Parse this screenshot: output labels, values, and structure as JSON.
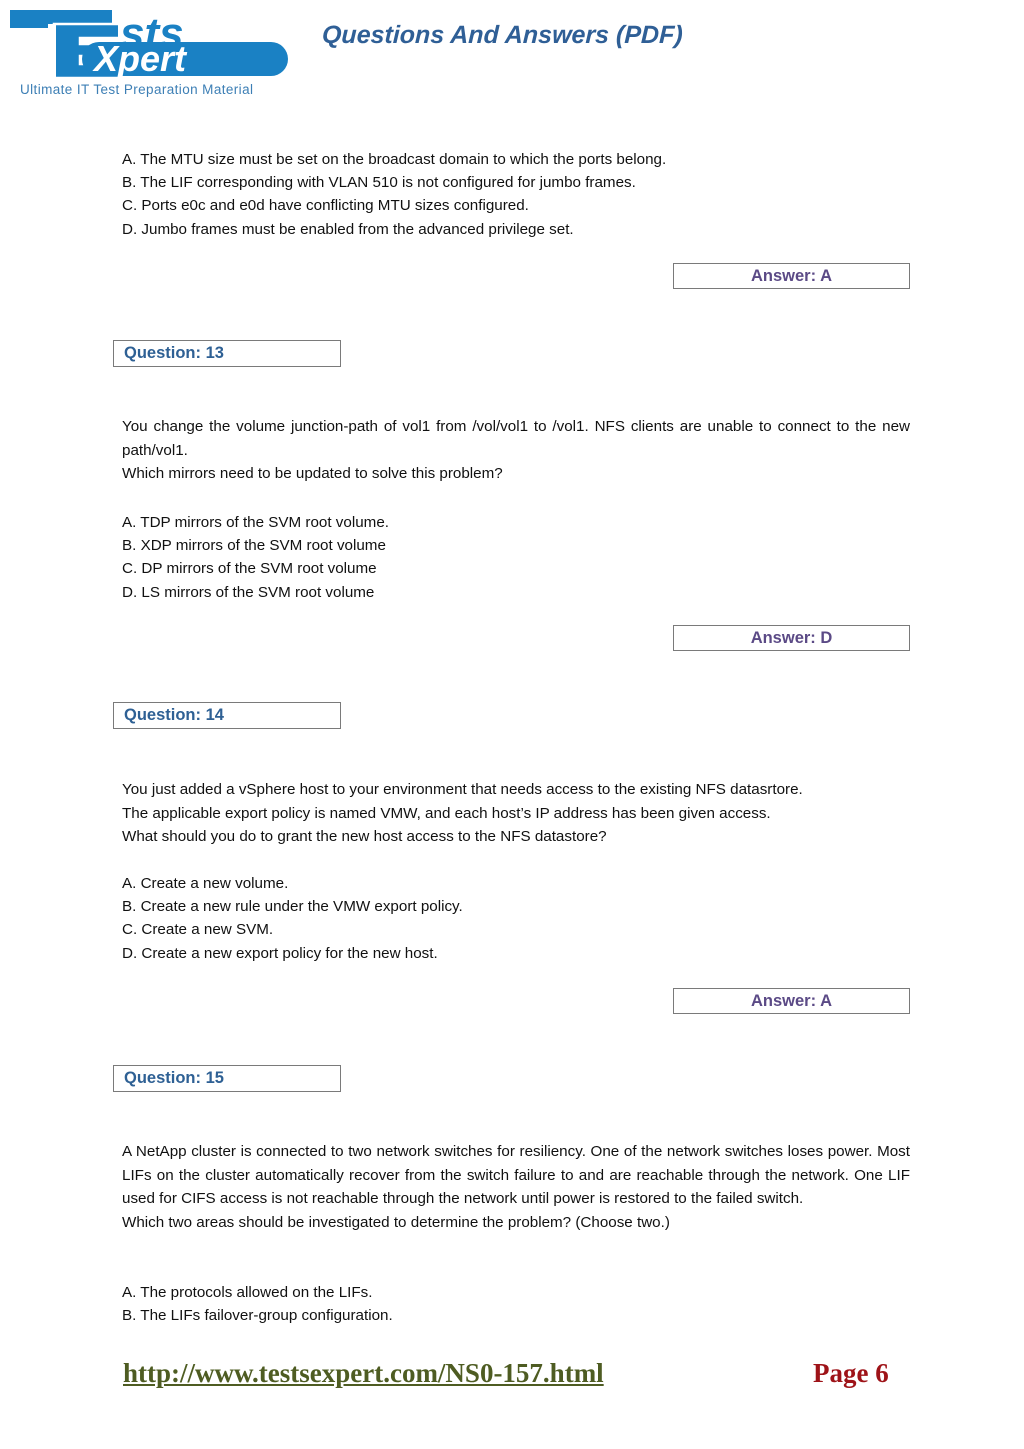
{
  "header": {
    "logo": {
      "name": "TestsExpert",
      "text_tests": "Tests",
      "text_expert": "Xpert",
      "text_e": "E",
      "text_t": "T",
      "tagline": "Ultimate IT Test Preparation Material",
      "brand_color": "#1a81c4"
    },
    "title": "Questions And Answers (PDF)",
    "title_color": "#2f5f96"
  },
  "colors": {
    "question_label": "#2e6094",
    "answer_label": "#5b4a86",
    "box_border": "#7a7a7a",
    "footer_url": "#4e5c22",
    "footer_page": "#9e1318",
    "body_text": "#111111"
  },
  "blocks": {
    "prev_question_options": [
      "A. The MTU size must be set on the broadcast domain to which the ports belong.",
      "B. The LIF corresponding with VLAN 510 is not configured for jumbo frames.",
      "C. Ports e0c and e0d have conflicting MTU sizes configured.",
      "D. Jumbo frames must be enabled from the advanced privilege set."
    ],
    "prev_question_answer": "Answer: A"
  },
  "questions": [
    {
      "label": "Question: 13",
      "body_justified": "You change the volume junction-path of vol1 from /vol/vol1 to /vol1. NFS clients are unable to connect to the new path/vol1.",
      "body_extra": "Which mirrors need to be updated to solve this problem?",
      "options": [
        "A. TDP mirrors of the SVM root volume.",
        "B. XDP mirrors of the SVM root volume",
        "C. DP mirrors of the SVM root volume",
        "D. LS mirrors of the SVM root volume"
      ],
      "answer": "Answer: D"
    },
    {
      "label": "Question: 14",
      "body_justified": "You just added a vSphere host to your environment that needs access to the existing NFS datasrtore.",
      "body_line2": "The applicable export policy is named VMW, and each host’s IP address has been given access.",
      "body_extra": "What should you do to grant the new host access to the NFS datastore?",
      "options": [
        "A. Create a new volume.",
        "B. Create a new rule under the VMW export policy.",
        "C. Create a new SVM.",
        "D. Create a new export policy for the new host."
      ],
      "answer": "Answer: A"
    },
    {
      "label": "Question: 15",
      "body_justified": "A NetApp cluster is connected to two network switches for resiliency. One of the network switches loses power. Most LIFs on the cluster automatically recover from the switch failure to and are reachable through the network. One LIF used for CIFS access is not reachable through the network until power is restored to the failed switch.",
      "body_extra": "Which two areas should be investigated to determine the problem? (Choose two.)",
      "options": [
        "A. The protocols allowed on the LIFs.",
        "B. The LIFs failover-group configuration."
      ],
      "answer": null
    }
  ],
  "footer": {
    "url": "http://www.testsexpert.com/NS0-157.html",
    "page": "Page 6"
  }
}
